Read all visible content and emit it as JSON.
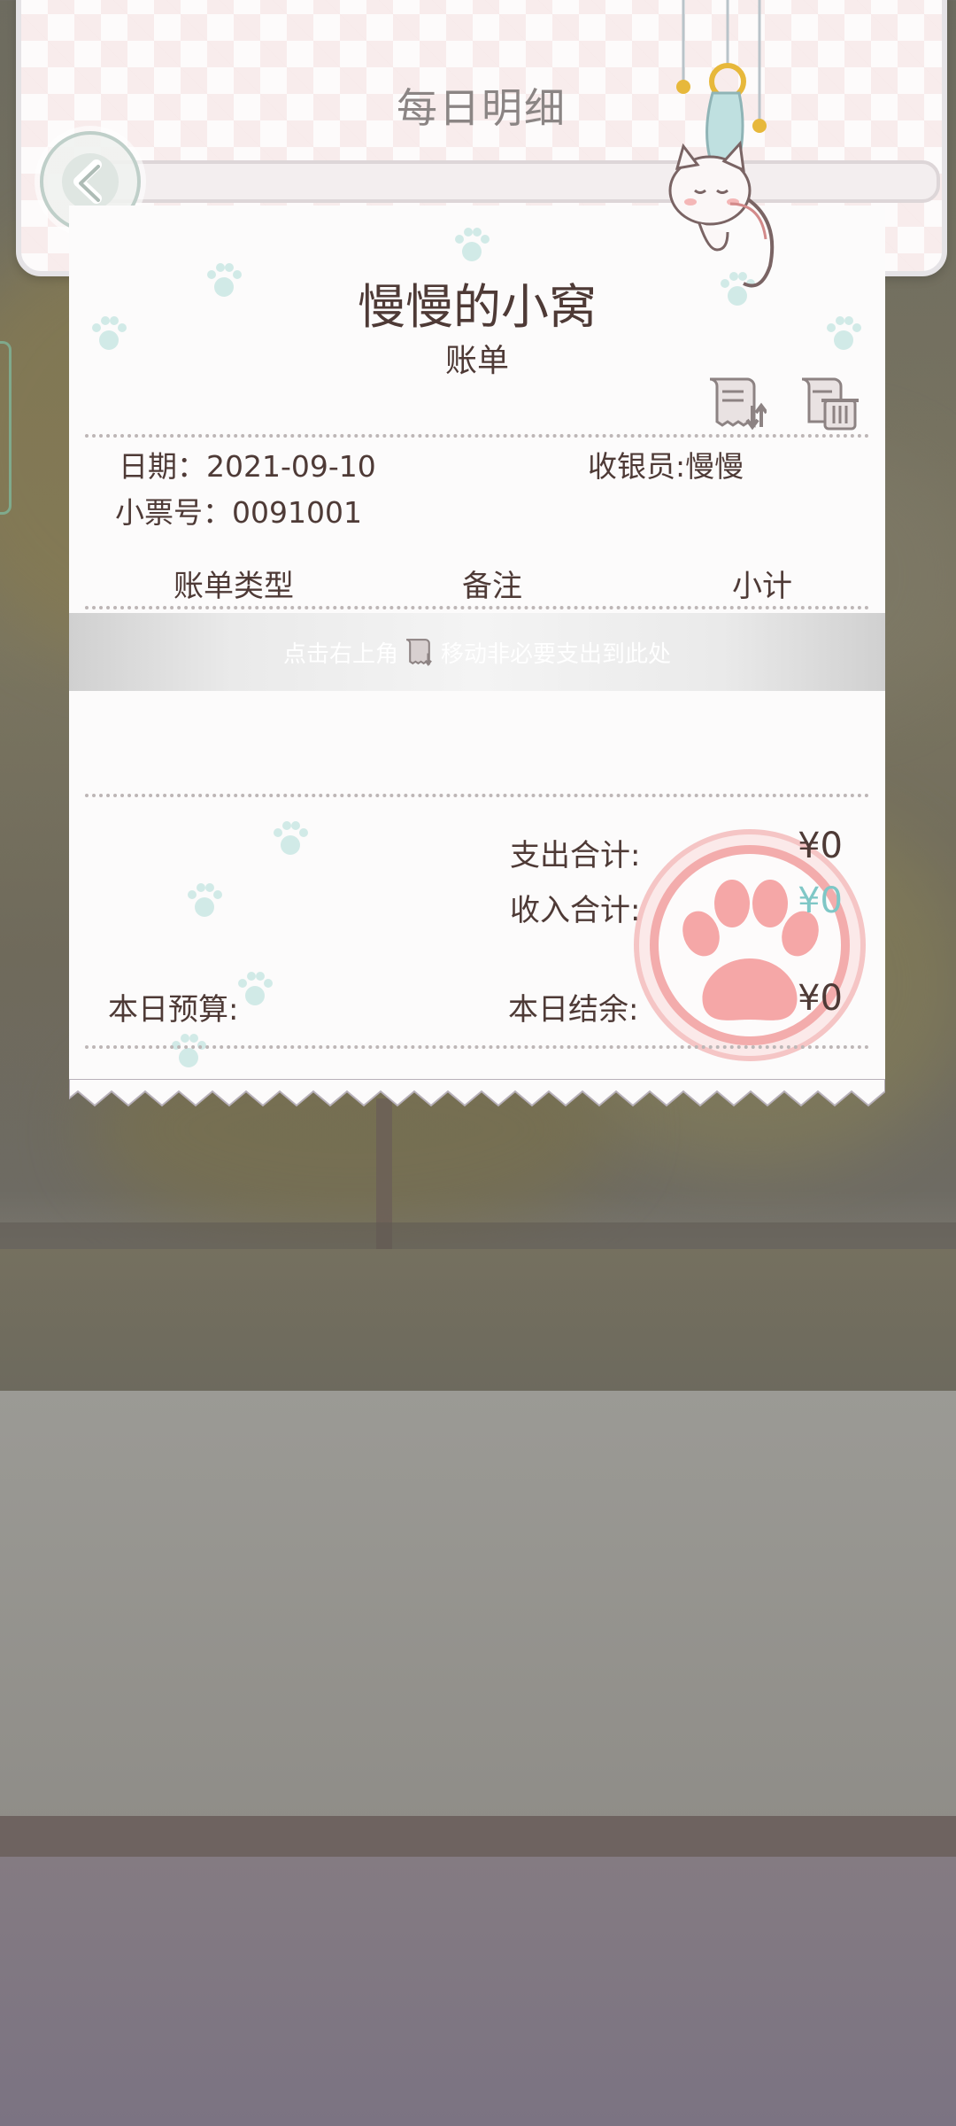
{
  "header": {
    "title": "每日明细"
  },
  "receipt": {
    "shop_name": "慢慢的小窝",
    "bill_label": "账单",
    "date_label": "日期：",
    "date_value": "2021-09-10",
    "cashier_label": "收银员:",
    "cashier_value": "慢慢",
    "ticket_label": "小票号：",
    "ticket_value": "0091001",
    "columns": [
      "账单类型",
      "备注",
      "小计"
    ],
    "hint_before": "点击右上角",
    "hint_after": "移动非必要支出到此处",
    "expense_total_label": "支出合计:",
    "expense_total_value": "¥0",
    "income_total_label": "收入合计:",
    "income_total_value": "¥0",
    "daily_budget_label": "本日预算:",
    "daily_balance_label": "本日结余:",
    "daily_balance_value": "¥0"
  },
  "colors": {
    "text": "#4e3a36",
    "income": "#7fc7c6",
    "stamp": "#f08a8a"
  },
  "icons": {
    "back": "chevron-left-icon",
    "move": "receipt-move-icon",
    "delete": "receipt-trash-icon",
    "stamp": "paw-stamp-icon"
  }
}
